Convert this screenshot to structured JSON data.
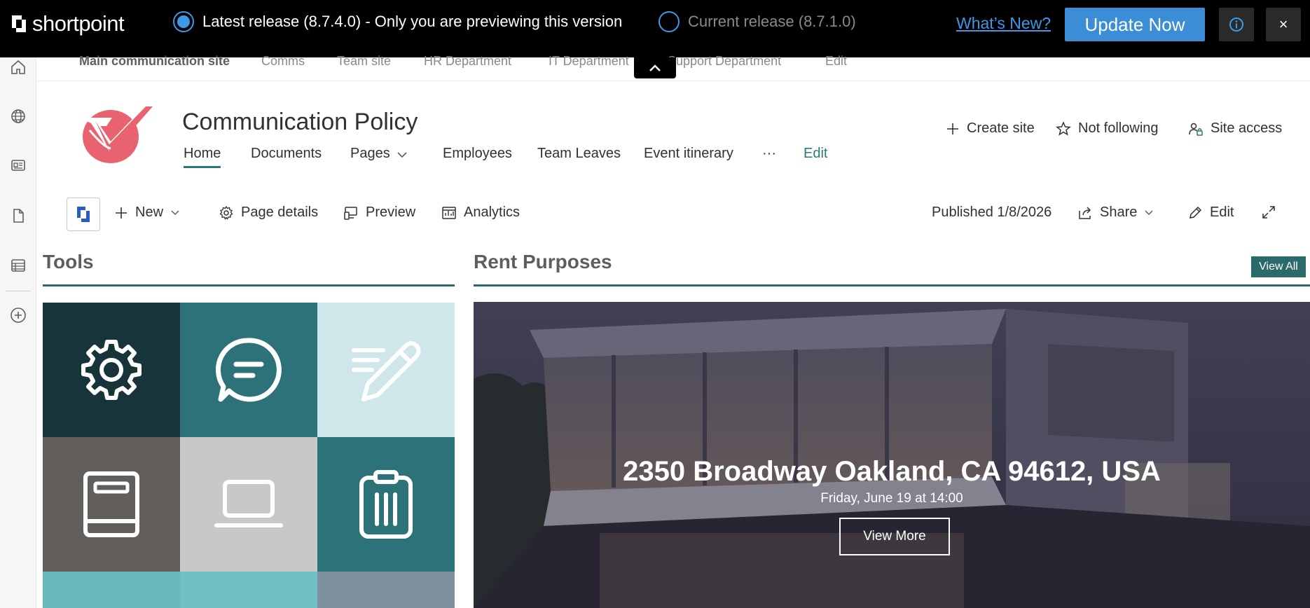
{
  "banner": {
    "logo_text": "shortpoint",
    "latest_release": "Latest release (8.7.4.0) - Only you are previewing this version",
    "current_release": "Current release (8.7.1.0)",
    "whats_new": "What’s New?",
    "update_now": "Update Now",
    "close": "×"
  },
  "hub_nav": {
    "items": [
      "Main communication site",
      "Comms",
      "Team site",
      "HR Department",
      "IT Department",
      "Support Department",
      "Edit"
    ]
  },
  "site": {
    "title": "Communication Policy",
    "nav": [
      "Home",
      "Documents",
      "Pages",
      "Employees",
      "Team Leaves",
      "Event itinerary",
      "···",
      "Edit"
    ],
    "actions": {
      "create_site": "Create site",
      "following": "Not following",
      "site_access": "Site access"
    },
    "brand_color": "#e8626f",
    "accent_color": "#2a7a78"
  },
  "command_bar": {
    "new": "New",
    "page_details": "Page details",
    "preview": "Preview",
    "analytics": "Analytics",
    "published": "Published 1/8/2026",
    "share": "Share",
    "edit": "Edit"
  },
  "tools": {
    "title": "Tools",
    "tiles": [
      {
        "icon": "gear-icon",
        "color": "#163439"
      },
      {
        "icon": "chat-icon",
        "color": "#2d7279"
      },
      {
        "icon": "notes-pen-icon",
        "color": "#cfe7ea"
      },
      {
        "icon": "book-icon",
        "color": "#615e5c"
      },
      {
        "icon": "laptop-icon",
        "color": "#c8c8c8"
      },
      {
        "icon": "clipboard-icon",
        "color": "#2d7279"
      }
    ]
  },
  "rent": {
    "title": "Rent Purposes",
    "view_all": "View All",
    "address": "2350 Broadway Oakland, CA 94612, USA",
    "date": "Friday, June 19 at 14:00",
    "view_more": "View More"
  }
}
